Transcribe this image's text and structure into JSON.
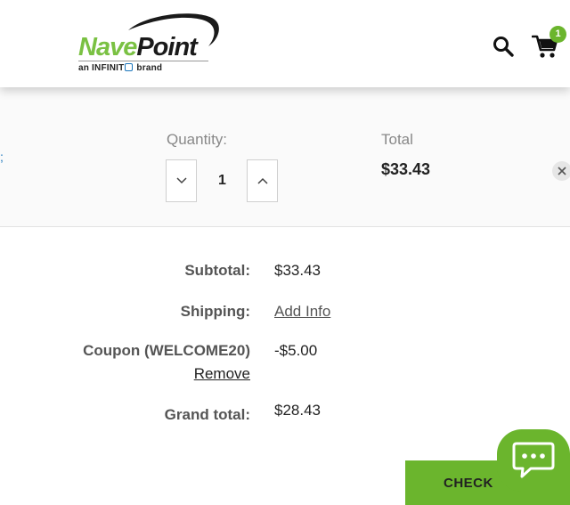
{
  "brand": {
    "name_part1": "Nave",
    "name_part2": "Point",
    "tagline_pre": "an INFINIT",
    "tagline_post": " brand",
    "colors": {
      "green": "#7ac143",
      "dark": "#1a1a1a",
      "accent_blue": "#1a75bb"
    }
  },
  "header": {
    "search_icon": "search-icon",
    "cart_icon": "cart-icon",
    "cart_count": "1"
  },
  "cart_item": {
    "quantity_label": "Quantity:",
    "quantity_value": "1",
    "total_label": "Total",
    "total_value": "$33.43",
    "decrease_icon": "chevron-down-icon",
    "increase_icon": "chevron-up-icon",
    "remove_icon": "close-icon"
  },
  "summary": {
    "subtotal_label": "Subtotal:",
    "subtotal_value": "$33.43",
    "shipping_label": "Shipping:",
    "shipping_value": "Add Info",
    "coupon_label": "Coupon (WELCOME20)",
    "coupon_value": "-$5.00",
    "coupon_remove": "Remove",
    "grand_total_label": "Grand total:",
    "grand_total_value": "$28.43"
  },
  "checkout": {
    "label": "CHECK",
    "color": "#6bb52d"
  },
  "chat": {
    "icon": "chat-icon"
  }
}
